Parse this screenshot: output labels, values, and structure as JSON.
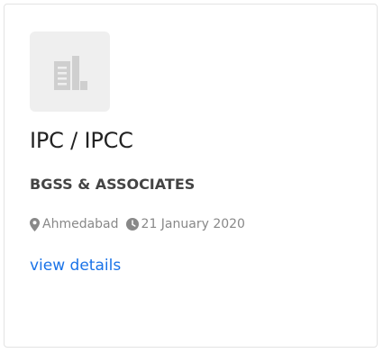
{
  "job": {
    "title": "IPC / IPCC",
    "company": "BGSS & ASSOCIATES",
    "location": "Ahmedabad",
    "date": "21 January 2020",
    "details_link": "view details"
  },
  "icons": {
    "logo": "building-icon",
    "location": "map-marker-icon",
    "date": "clock-icon"
  },
  "colors": {
    "link": "#1a73e8",
    "meta_text": "#888888",
    "logo_bg": "#efefef"
  }
}
